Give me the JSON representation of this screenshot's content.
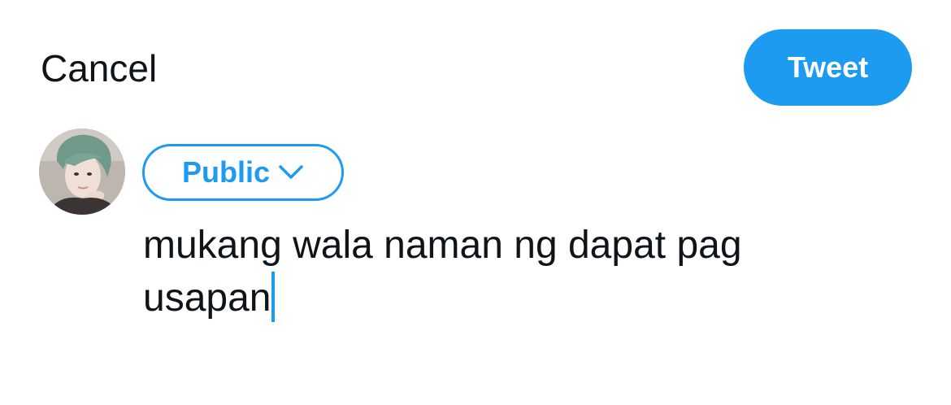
{
  "header": {
    "cancel_label": "Cancel",
    "tweet_label": "Tweet"
  },
  "composer": {
    "audience_label": "Public",
    "text_line1": "mukang wala naman ng dapat pag",
    "text_line2": "usapan"
  },
  "colors": {
    "accent": "#1d9bf0",
    "text": "#0f1419",
    "background": "#ffffff"
  },
  "icons": {
    "audience_chevron": "chevron-down-icon",
    "avatar": "profile-avatar"
  }
}
